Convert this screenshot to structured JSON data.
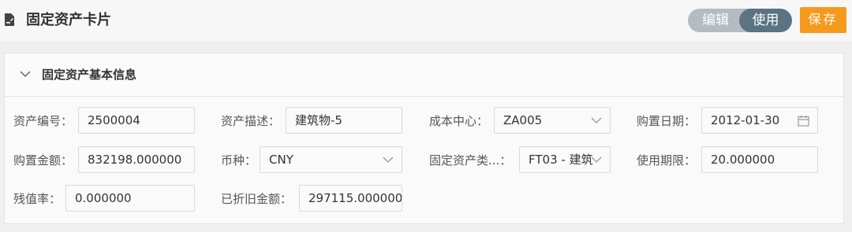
{
  "header": {
    "title": "固定资产卡片",
    "icon": "document-edit-icon",
    "mode_edit_label": "编辑",
    "mode_use_label": "使用",
    "save_label": "保存"
  },
  "section": {
    "title": "固定资产基本信息",
    "toggle_icon": "chevron-down-icon"
  },
  "fields": {
    "asset_no": {
      "label": "资产编号：",
      "value": "2500004"
    },
    "asset_desc": {
      "label": "资产描述：",
      "value": "建筑物-5"
    },
    "cost_center": {
      "label": "成本中心：",
      "value": "ZA005"
    },
    "purchase_date": {
      "label": "购置日期：",
      "value": "2012-01-30"
    },
    "purchase_amt": {
      "label": "购置金额：",
      "value": "832198.000000"
    },
    "currency": {
      "label": "币种：",
      "value": "CNY"
    },
    "asset_class": {
      "label": "固定资产类...：",
      "value": "FT03 - 建筑"
    },
    "useful_life": {
      "label": "使用期限：",
      "value": "20.000000"
    },
    "residual_rate": {
      "label": "残值率：",
      "value": "0.000000"
    },
    "accum_depr": {
      "label": "已折旧金额：",
      "value": "297115.000000"
    }
  },
  "colors": {
    "accent_save": "#f59a1d",
    "toggle_active": "#5b7383",
    "toggle_inactive": "#b2bcc2"
  }
}
